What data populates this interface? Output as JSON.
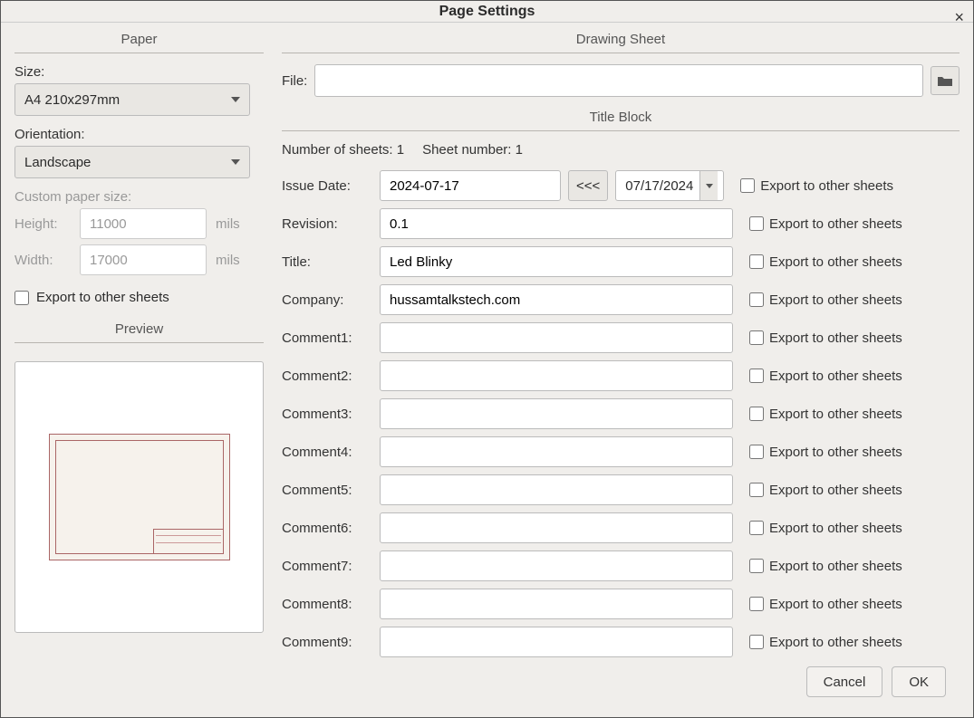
{
  "title": "Page Settings",
  "paper": {
    "header": "Paper",
    "size_label": "Size:",
    "size_value": "A4 210x297mm",
    "orientation_label": "Orientation:",
    "orientation_value": "Landscape",
    "custom_label": "Custom paper size:",
    "height_label": "Height:",
    "height_value": "11000",
    "width_label": "Width:",
    "width_value": "17000",
    "unit": "mils",
    "export_label": "Export to other sheets"
  },
  "preview": {
    "header": "Preview"
  },
  "drawing_sheet": {
    "header": "Drawing Sheet",
    "file_label": "File:",
    "file_value": ""
  },
  "title_block": {
    "header": "Title Block",
    "sheets_label": "Number of sheets: 1",
    "sheet_number_label": "Sheet number: 1",
    "arrow": "<<<",
    "rows": [
      {
        "label": "Issue Date:",
        "value": "2024-07-17",
        "picker": "07/17/2024",
        "type": "date"
      },
      {
        "label": "Revision:",
        "value": "0.1",
        "type": "text"
      },
      {
        "label": "Title:",
        "value": "Led Blinky",
        "type": "text"
      },
      {
        "label": "Company:",
        "value": "hussamtalkstech.com",
        "type": "text"
      },
      {
        "label": "Comment1:",
        "value": "",
        "type": "text"
      },
      {
        "label": "Comment2:",
        "value": "",
        "type": "text"
      },
      {
        "label": "Comment3:",
        "value": "",
        "type": "text"
      },
      {
        "label": "Comment4:",
        "value": "",
        "type": "text"
      },
      {
        "label": "Comment5:",
        "value": "",
        "type": "text"
      },
      {
        "label": "Comment6:",
        "value": "",
        "type": "text"
      },
      {
        "label": "Comment7:",
        "value": "",
        "type": "text"
      },
      {
        "label": "Comment8:",
        "value": "",
        "type": "text"
      },
      {
        "label": "Comment9:",
        "value": "",
        "type": "text"
      }
    ],
    "export_label": "Export to other sheets"
  },
  "footer": {
    "cancel": "Cancel",
    "ok": "OK"
  }
}
